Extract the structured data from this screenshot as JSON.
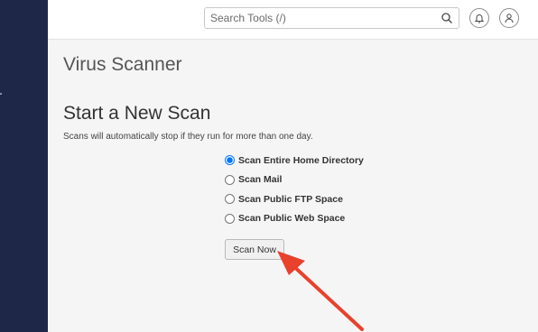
{
  "search": {
    "placeholder": "Search Tools (/)"
  },
  "page": {
    "title": "Virus Scanner"
  },
  "scan": {
    "heading": "Start a New Scan",
    "note": "Scans will automatically stop if they run for more than one day.",
    "options": [
      {
        "label": "Scan Entire Home Directory",
        "selected": true
      },
      {
        "label": "Scan Mail",
        "selected": false
      },
      {
        "label": "Scan Public FTP Space",
        "selected": false
      },
      {
        "label": "Scan Public Web Space",
        "selected": false
      }
    ],
    "button_label": "Scan Now"
  },
  "colors": {
    "sidebar": "#1e2747",
    "arrow": "#e8412c",
    "radio": "#2b6fd6"
  },
  "icons": [
    "search-icon",
    "bell-icon",
    "user-icon"
  ]
}
